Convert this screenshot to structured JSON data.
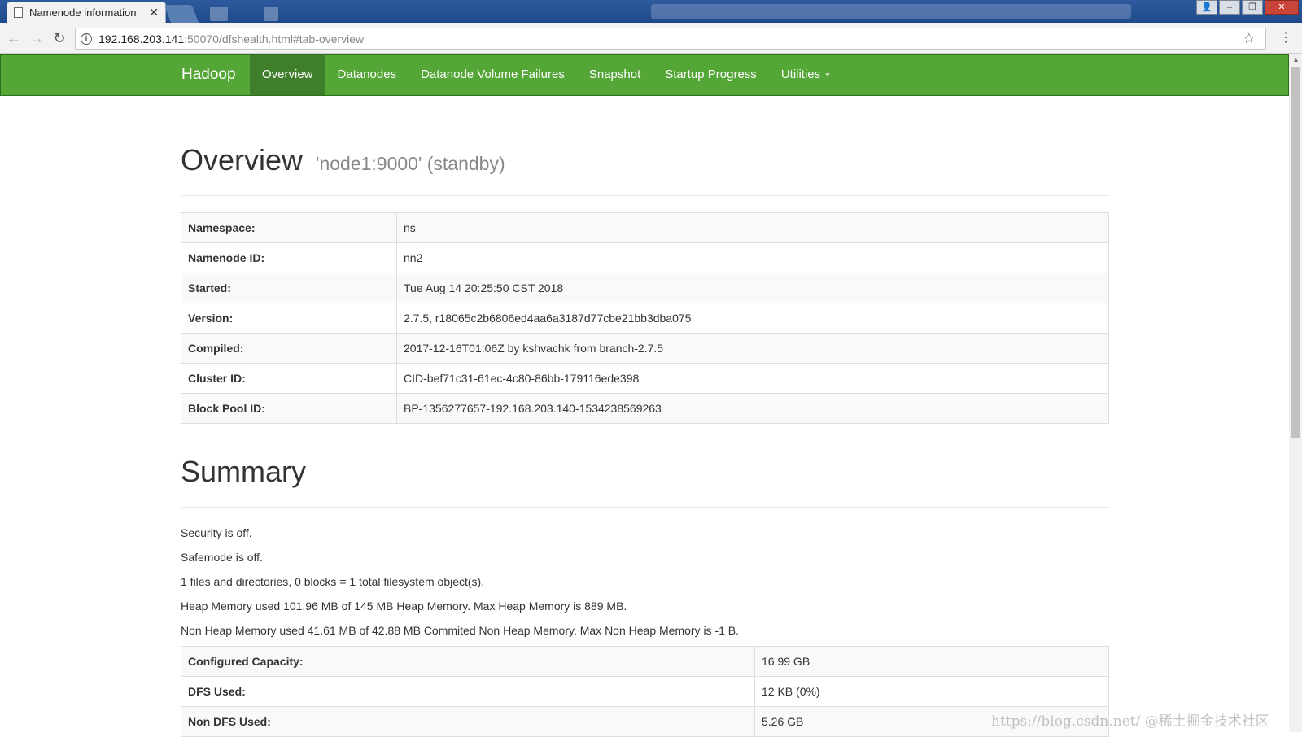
{
  "browser": {
    "tab_title": "Namenode information",
    "tab_close": "✕",
    "url_host": "192.168.203.141",
    "url_rest": ":50070/dfshealth.html#tab-overview",
    "back_icon": "←",
    "forward_icon": "→",
    "reload_icon": "↻",
    "info_icon": "i",
    "star_icon": "☆",
    "menu_icon": "⋮",
    "window_buttons": {
      "user": "👤",
      "minimize": "–",
      "maximize": "❐",
      "close": "✕"
    }
  },
  "navbar": {
    "brand": "Hadoop",
    "items": [
      {
        "label": "Overview",
        "active": true
      },
      {
        "label": "Datanodes",
        "active": false
      },
      {
        "label": "Datanode Volume Failures",
        "active": false
      },
      {
        "label": "Snapshot",
        "active": false
      },
      {
        "label": "Startup Progress",
        "active": false
      },
      {
        "label": "Utilities",
        "active": false,
        "dropdown": true
      }
    ],
    "color": "#54a637",
    "active_color": "#3f7e2a"
  },
  "overview": {
    "title": "Overview",
    "subtitle": "'node1:9000' (standby)",
    "rows": [
      {
        "label": "Namespace:",
        "value": "ns"
      },
      {
        "label": "Namenode ID:",
        "value": "nn2"
      },
      {
        "label": "Started:",
        "value": "Tue Aug 14 20:25:50 CST 2018"
      },
      {
        "label": "Version:",
        "value": "2.7.5, r18065c2b6806ed4aa6a3187d77cbe21bb3dba075"
      },
      {
        "label": "Compiled:",
        "value": "2017-12-16T01:06Z by kshvachk from branch-2.7.5"
      },
      {
        "label": "Cluster ID:",
        "value": "CID-bef71c31-61ec-4c80-86bb-179116ede398"
      },
      {
        "label": "Block Pool ID:",
        "value": "BP-1356277657-192.168.203.140-1534238569263"
      }
    ]
  },
  "summary": {
    "title": "Summary",
    "lines": [
      "Security is off.",
      "Safemode is off.",
      "1 files and directories, 0 blocks = 1 total filesystem object(s).",
      "Heap Memory used 101.96 MB of 145 MB Heap Memory. Max Heap Memory is 889 MB.",
      "Non Heap Memory used 41.61 MB of 42.88 MB Commited Non Heap Memory. Max Non Heap Memory is -1 B."
    ],
    "rows": [
      {
        "label": "Configured Capacity:",
        "value": "16.99 GB"
      },
      {
        "label": "DFS Used:",
        "value": "12 KB (0%)"
      },
      {
        "label": "Non DFS Used:",
        "value": "5.26 GB"
      }
    ]
  },
  "watermark": "https://blog.csdn.net/ @稀土掘金技术社区"
}
